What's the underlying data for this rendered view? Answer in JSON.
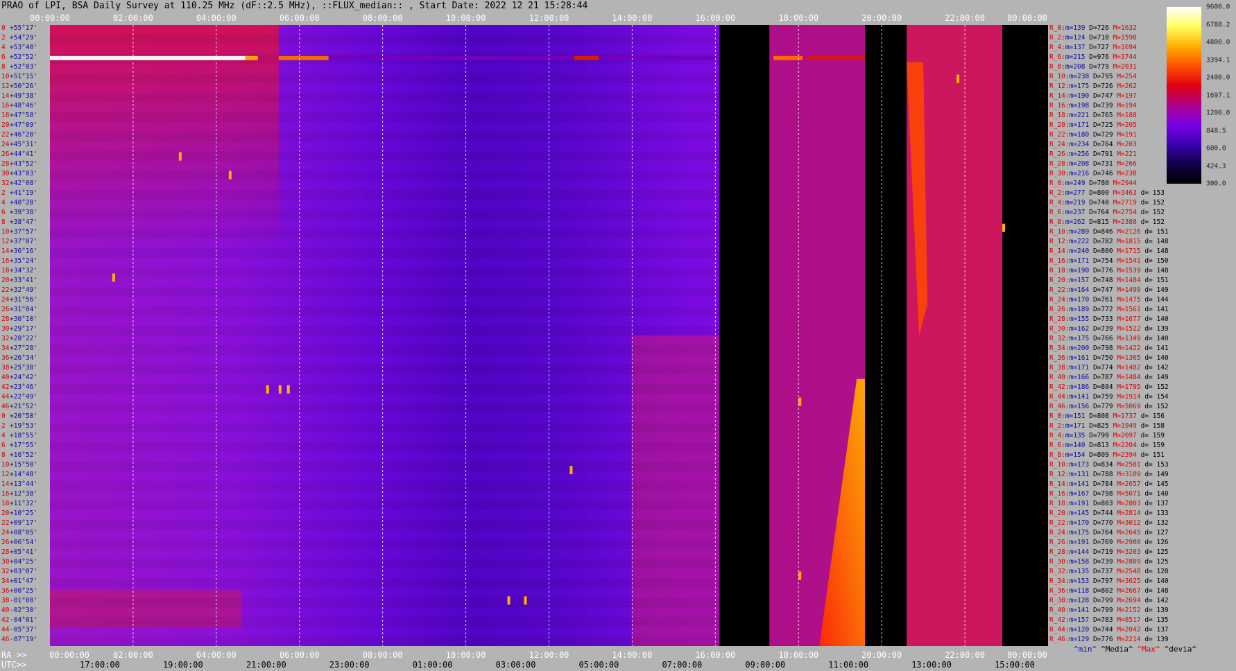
{
  "title": "PRAO of LPI, BSA Daily Survey at 110.25 MHz (dF::2.5 MHz), ::FLUX_median:: , Start Date: 2022 12 21 15:28:44",
  "top_ticks": [
    "00:00:00",
    "02:00:00",
    "04:00:00",
    "06:00:00",
    "08:00:00",
    "10:00:00",
    "12:00:00",
    "14:00:00",
    "16:00:00",
    "18:00:00",
    "20:00:00",
    "22:00:00",
    "00:00:00"
  ],
  "ra_label": "RA >>",
  "utc_label": "UTC>>",
  "ra_ticks": [
    "00:00:00",
    "02:00:00",
    "04:00:00",
    "06:00:00",
    "08:00:00",
    "10:00:00",
    "12:00:00",
    "14:00:00",
    "16:00:00",
    "18:00:00",
    "20:00:00",
    "22:00:00",
    "00:00:00"
  ],
  "utc_ticks": [
    "17:00:00",
    "19:00:00",
    "21:00:00",
    "23:00:00",
    "01:00:00",
    "03:00:00",
    "05:00:00",
    "07:00:00",
    "09:00:00",
    "11:00:00",
    "13:00:00",
    "15:00:00"
  ],
  "colorbar": {
    "labels": [
      "9600.0",
      "6788.2",
      "4800.0",
      "3394.1",
      "2400.0",
      "1697.1",
      "1200.0",
      "848.5",
      "600.0",
      "424.3",
      "300.0"
    ],
    "colors": [
      "#ffffff",
      "#ffff60",
      "#ffb000",
      "#ff5000",
      "#e00010",
      "#b0008a",
      "#7a00e6",
      "#3a00b0",
      "#10004a",
      "#000000"
    ]
  },
  "rows": [
    {
      "i": "0",
      "d": "+55°17'"
    },
    {
      "i": "2",
      "d": "+54°29'"
    },
    {
      "i": "4",
      "d": "+53°40'"
    },
    {
      "i": "6",
      "d": "+52°52'"
    },
    {
      "i": "8",
      "d": "+52°03'"
    },
    {
      "i": "10",
      "d": "+51°15'"
    },
    {
      "i": "12",
      "d": "+50°26'"
    },
    {
      "i": "14",
      "d": "+49°38'"
    },
    {
      "i": "16",
      "d": "+48°46'"
    },
    {
      "i": "18",
      "d": "+47°58'"
    },
    {
      "i": "20",
      "d": "+47°09'"
    },
    {
      "i": "22",
      "d": "+46°20'"
    },
    {
      "i": "24",
      "d": "+45°31'"
    },
    {
      "i": "26",
      "d": "+44°41'"
    },
    {
      "i": "28",
      "d": "+43°52'"
    },
    {
      "i": "30",
      "d": "+43°03'"
    },
    {
      "i": "32",
      "d": "+42°08'"
    },
    {
      "i": "2",
      "d": "+41°19'"
    },
    {
      "i": "4",
      "d": "+40°28'"
    },
    {
      "i": "6",
      "d": "+39°38'"
    },
    {
      "i": "8",
      "d": "+38°47'"
    },
    {
      "i": "10",
      "d": "+37°57'"
    },
    {
      "i": "12",
      "d": "+37°07'"
    },
    {
      "i": "14",
      "d": "+36°16'"
    },
    {
      "i": "16",
      "d": "+35°24'"
    },
    {
      "i": "18",
      "d": "+34°32'"
    },
    {
      "i": "20",
      "d": "+33°41'"
    },
    {
      "i": "22",
      "d": "+32°49'"
    },
    {
      "i": "24",
      "d": "+31°56'"
    },
    {
      "i": "26",
      "d": "+31°04'"
    },
    {
      "i": "28",
      "d": "+30°10'"
    },
    {
      "i": "30",
      "d": "+29°17'"
    },
    {
      "i": "32",
      "d": "+28°22'"
    },
    {
      "i": "34",
      "d": "+27°28'"
    },
    {
      "i": "36",
      "d": "+26°34'"
    },
    {
      "i": "38",
      "d": "+25°38'"
    },
    {
      "i": "40",
      "d": "+24°42'"
    },
    {
      "i": "42",
      "d": "+23°46'"
    },
    {
      "i": "44",
      "d": "+22°49'"
    },
    {
      "i": "46",
      "d": "+21°52'"
    },
    {
      "i": "0",
      "d": "+20°50'"
    },
    {
      "i": "2",
      "d": "+19°53'"
    },
    {
      "i": "4",
      "d": "+18°55'"
    },
    {
      "i": "6",
      "d": "+17°55'"
    },
    {
      "i": "8",
      "d": "+16°52'"
    },
    {
      "i": "10",
      "d": "+15°50'"
    },
    {
      "i": "12",
      "d": "+14°48'"
    },
    {
      "i": "14",
      "d": "+13°44'"
    },
    {
      "i": "16",
      "d": "+12°38'"
    },
    {
      "i": "18",
      "d": "+11°32'"
    },
    {
      "i": "20",
      "d": "+10°25'"
    },
    {
      "i": "22",
      "d": "+09°17'"
    },
    {
      "i": "24",
      "d": "+08°05'"
    },
    {
      "i": "26",
      "d": "+06°54'"
    },
    {
      "i": "28",
      "d": "+05°41'"
    },
    {
      "i": "30",
      "d": "+04°25'"
    },
    {
      "i": "32",
      "d": "+03°07'"
    },
    {
      "i": "34",
      "d": "+01°47'"
    },
    {
      "i": "36",
      "d": "+00°25'"
    },
    {
      "i": "38",
      "d": "-01°00'"
    },
    {
      "i": "40",
      "d": "-02°30'"
    },
    {
      "i": "42",
      "d": "-04°01'"
    },
    {
      "i": "44",
      "d": "-05°37'"
    },
    {
      "i": "46",
      "d": "-07°19'"
    }
  ],
  "stats": [
    {
      "r": "R_0:",
      "m": "m=139",
      "D": "D=726",
      "M": "M=1632",
      "d": ""
    },
    {
      "r": "R_2:",
      "m": "m=124",
      "D": "D=710",
      "M": "M=1598",
      "d": ""
    },
    {
      "r": "R_4:",
      "m": "m=137",
      "D": "D=727",
      "M": "M=1694",
      "d": ""
    },
    {
      "r": "R_6:",
      "m": "m=215",
      "D": "D=976",
      "M": "M=3744",
      "d": ""
    },
    {
      "r": "R_8:",
      "m": "m=208",
      "D": "D=779",
      "M": "M=2031",
      "d": ""
    },
    {
      "r": "R_10:",
      "m": "m=238",
      "D": "D=795",
      "M": "M=254",
      "d": ""
    },
    {
      "r": "R_12:",
      "m": "m=175",
      "D": "D=726",
      "M": "M=262",
      "d": ""
    },
    {
      "r": "R_14:",
      "m": "m=190",
      "D": "D=747",
      "M": "M=197",
      "d": ""
    },
    {
      "r": "R_16:",
      "m": "m=198",
      "D": "D=739",
      "M": "M=194",
      "d": ""
    },
    {
      "r": "R_18:",
      "m": "m=221",
      "D": "D=765",
      "M": "M=188",
      "d": ""
    },
    {
      "r": "R_20:",
      "m": "m=171",
      "D": "D=725",
      "M": "M=205",
      "d": ""
    },
    {
      "r": "R_22:",
      "m": "m=180",
      "D": "D=729",
      "M": "M=191",
      "d": ""
    },
    {
      "r": "R_24:",
      "m": "m=234",
      "D": "D=764",
      "M": "M=203",
      "d": ""
    },
    {
      "r": "R_26:",
      "m": "m=256",
      "D": "D=791",
      "M": "M=221",
      "d": ""
    },
    {
      "r": "R_28:",
      "m": "m=208",
      "D": "D=731",
      "M": "M=266",
      "d": ""
    },
    {
      "r": "R_30:",
      "m": "m=216",
      "D": "D=746",
      "M": "M=238",
      "d": ""
    },
    {
      "r": "R_0:",
      "m": "m=249",
      "D": "D=780",
      "M": "M=2944",
      "d": ""
    },
    {
      "r": "R_2:",
      "m": "m=277",
      "D": "D=800",
      "M": "M=3463",
      "d": "d= 153"
    },
    {
      "r": "R_4:",
      "m": "m=219",
      "D": "D=740",
      "M": "M=2719",
      "d": "d= 152"
    },
    {
      "r": "R_6:",
      "m": "m=237",
      "D": "D=764",
      "M": "M=2754",
      "d": "d= 152"
    },
    {
      "r": "R_8:",
      "m": "m=262",
      "D": "D=815",
      "M": "M=2388",
      "d": "d= 152"
    },
    {
      "r": "R_10:",
      "m": "m=289",
      "D": "D=846",
      "M": "M=2126",
      "d": "d= 151"
    },
    {
      "r": "R_12:",
      "m": "m=222",
      "D": "D=782",
      "M": "M=1815",
      "d": "d= 148"
    },
    {
      "r": "R_14:",
      "m": "m=240",
      "D": "D=800",
      "M": "M=1715",
      "d": "d= 148"
    },
    {
      "r": "R_16:",
      "m": "m=171",
      "D": "D=754",
      "M": "M=1541",
      "d": "d= 150"
    },
    {
      "r": "R_18:",
      "m": "m=190",
      "D": "D=776",
      "M": "M=1539",
      "d": "d= 148"
    },
    {
      "r": "R_20:",
      "m": "m=157",
      "D": "D=748",
      "M": "M=1484",
      "d": "d= 151"
    },
    {
      "r": "R_22:",
      "m": "m=164",
      "D": "D=747",
      "M": "M=1490",
      "d": "d= 149"
    },
    {
      "r": "R_24:",
      "m": "m=170",
      "D": "D=761",
      "M": "M=1475",
      "d": "d= 144"
    },
    {
      "r": "R_26:",
      "m": "m=189",
      "D": "D=772",
      "M": "M=1561",
      "d": "d= 141"
    },
    {
      "r": "R_28:",
      "m": "m=155",
      "D": "D=733",
      "M": "M=1677",
      "d": "d= 140"
    },
    {
      "r": "R_30:",
      "m": "m=162",
      "D": "D=739",
      "M": "M=1522",
      "d": "d= 139"
    },
    {
      "r": "R_32:",
      "m": "m=175",
      "D": "D=766",
      "M": "M=1349",
      "d": "d= 140"
    },
    {
      "r": "R_34:",
      "m": "m=200",
      "D": "D=798",
      "M": "M=1422",
      "d": "d= 141"
    },
    {
      "r": "R_36:",
      "m": "m=161",
      "D": "D=750",
      "M": "M=1365",
      "d": "d= 140"
    },
    {
      "r": "R_38:",
      "m": "m=171",
      "D": "D=774",
      "M": "M=1482",
      "d": "d= 142"
    },
    {
      "r": "R_40:",
      "m": "m=166",
      "D": "D=787",
      "M": "M=1484",
      "d": "d= 149"
    },
    {
      "r": "R_42:",
      "m": "m=186",
      "D": "D=804",
      "M": "M=1795",
      "d": "d= 152"
    },
    {
      "r": "R_44:",
      "m": "m=141",
      "D": "D=759",
      "M": "M=1914",
      "d": "d= 154"
    },
    {
      "r": "R_46:",
      "m": "m=156",
      "D": "D=779",
      "M": "M=5069",
      "d": "d= 152"
    },
    {
      "r": "R_0:",
      "m": "m=151",
      "D": "D=808",
      "M": "M=1737",
      "d": "d= 156"
    },
    {
      "r": "R_2:",
      "m": "m=171",
      "D": "D=825",
      "M": "M=1949",
      "d": "d= 158"
    },
    {
      "r": "R_4:",
      "m": "m=135",
      "D": "D=799",
      "M": "M=2097",
      "d": "d= 159"
    },
    {
      "r": "R_6:",
      "m": "m=140",
      "D": "D=813",
      "M": "M=2204",
      "d": "d= 159"
    },
    {
      "r": "R_8:",
      "m": "m=154",
      "D": "D=809",
      "M": "M=2394",
      "d": "d= 151"
    },
    {
      "r": "R_10:",
      "m": "m=173",
      "D": "D=834",
      "M": "M=2581",
      "d": "d= 153"
    },
    {
      "r": "R_12:",
      "m": "m=131",
      "D": "D=788",
      "M": "M=3109",
      "d": "d= 149"
    },
    {
      "r": "R_14:",
      "m": "m=141",
      "D": "D=784",
      "M": "M=2657",
      "d": "d= 145"
    },
    {
      "r": "R_16:",
      "m": "m=167",
      "D": "D=798",
      "M": "M=5071",
      "d": "d= 140"
    },
    {
      "r": "R_18:",
      "m": "m=191",
      "D": "D=803",
      "M": "M=2803",
      "d": "d= 137"
    },
    {
      "r": "R_20:",
      "m": "m=145",
      "D": "D=744",
      "M": "M=2814",
      "d": "d= 133"
    },
    {
      "r": "R_22:",
      "m": "m=170",
      "D": "D=770",
      "M": "M=3012",
      "d": "d= 132"
    },
    {
      "r": "R_24:",
      "m": "m=175",
      "D": "D=764",
      "M": "M=2645",
      "d": "d= 127"
    },
    {
      "r": "R_26:",
      "m": "m=191",
      "D": "D=769",
      "M": "M=2900",
      "d": "d= 126"
    },
    {
      "r": "R_28:",
      "m": "m=144",
      "D": "D=719",
      "M": "M=3203",
      "d": "d= 125"
    },
    {
      "r": "R_30:",
      "m": "m=158",
      "D": "D=739",
      "M": "M=2809",
      "d": "d= 125"
    },
    {
      "r": "R_32:",
      "m": "m=135",
      "D": "D=737",
      "M": "M=2548",
      "d": "d= 128"
    },
    {
      "r": "R_34:",
      "m": "m=153",
      "D": "D=797",
      "M": "M=3625",
      "d": "d= 140"
    },
    {
      "r": "R_36:",
      "m": "m=118",
      "D": "D=802",
      "M": "M=2667",
      "d": "d= 148"
    },
    {
      "r": "R_38:",
      "m": "m=128",
      "D": "D=799",
      "M": "M=2694",
      "d": "d= 142"
    },
    {
      "r": "R_40:",
      "m": "m=141",
      "D": "D=799",
      "M": "M=2152",
      "d": "d= 139"
    },
    {
      "r": "R_42:",
      "m": "m=157",
      "D": "D=783",
      "M": "M=8517",
      "d": "d= 135"
    },
    {
      "r": "R_44:",
      "m": "m=120",
      "D": "D=744",
      "M": "M=2042",
      "d": "d= 137"
    },
    {
      "r": "R_46:",
      "m": "m=129",
      "D": "D=776",
      "M": "M=2214",
      "d": "d= 139"
    }
  ],
  "footer": {
    "min": "^min^",
    "media": "^Media^",
    "max": "^Max^",
    "devia": "^devia^"
  },
  "chart_data": {
    "type": "heatmap",
    "title": "PRAO of LPI, BSA Daily Survey at 110.25 MHz (dF::2.5 MHz), ::FLUX_median:: , Start Date: 2022 12 21 15:28:44",
    "x_axis": "RA / UTC (hours)",
    "x_range_hours": [
      0,
      24
    ],
    "rows": 64,
    "colorscale_range": [
      300.0,
      9600.0
    ],
    "grid": true,
    "data_gaps_ra_hours": [
      [
        16.1,
        17.3
      ],
      [
        19.6,
        20.6
      ],
      [
        22.9,
        24.0
      ]
    ]
  }
}
